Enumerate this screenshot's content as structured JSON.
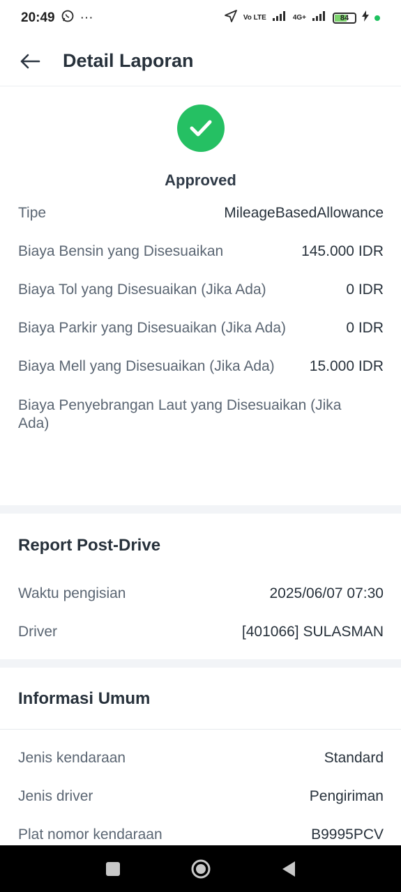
{
  "status_bar": {
    "time": "20:49",
    "more": "···",
    "volte": "Vo LTE",
    "network": "4G+",
    "battery": "84"
  },
  "header": {
    "title": "Detail Laporan"
  },
  "status": {
    "label": "Approved",
    "color": "#25c063"
  },
  "expense_rows": [
    {
      "label": "Tipe",
      "value": "MileageBasedAllowance"
    },
    {
      "label": "Biaya Bensin yang Disesuaikan",
      "value": "145.000 IDR"
    },
    {
      "label": "Biaya Tol yang Disesuaikan (Jika Ada)",
      "value": "0 IDR"
    },
    {
      "label": "Biaya Parkir yang Disesuaikan (Jika Ada)",
      "value": "0 IDR"
    },
    {
      "label": "Biaya Mell yang Disesuaikan (Jika Ada)",
      "value": "15.000 IDR"
    },
    {
      "label": "Biaya Penyebrangan Laut yang Disesuaikan (Jika Ada)",
      "value": ""
    }
  ],
  "post_drive": {
    "title": "Report Post-Drive",
    "rows": [
      {
        "label": "Waktu pengisian",
        "value": "2025/06/07 07:30"
      },
      {
        "label": "Driver",
        "value": "[401066] SULASMAN"
      }
    ]
  },
  "general_info": {
    "title": "Informasi Umum",
    "rows": [
      {
        "label": "Jenis kendaraan",
        "value": "Standard"
      },
      {
        "label": "Jenis driver",
        "value": "Pengiriman"
      },
      {
        "label": "Plat nomor kendaraan",
        "value": "B9995PCV"
      }
    ]
  },
  "icons": {
    "back": "arrow-left-icon",
    "status": "check-circle-icon",
    "nav": [
      "recent-apps-icon",
      "home-icon",
      "back-triangle-icon"
    ]
  }
}
